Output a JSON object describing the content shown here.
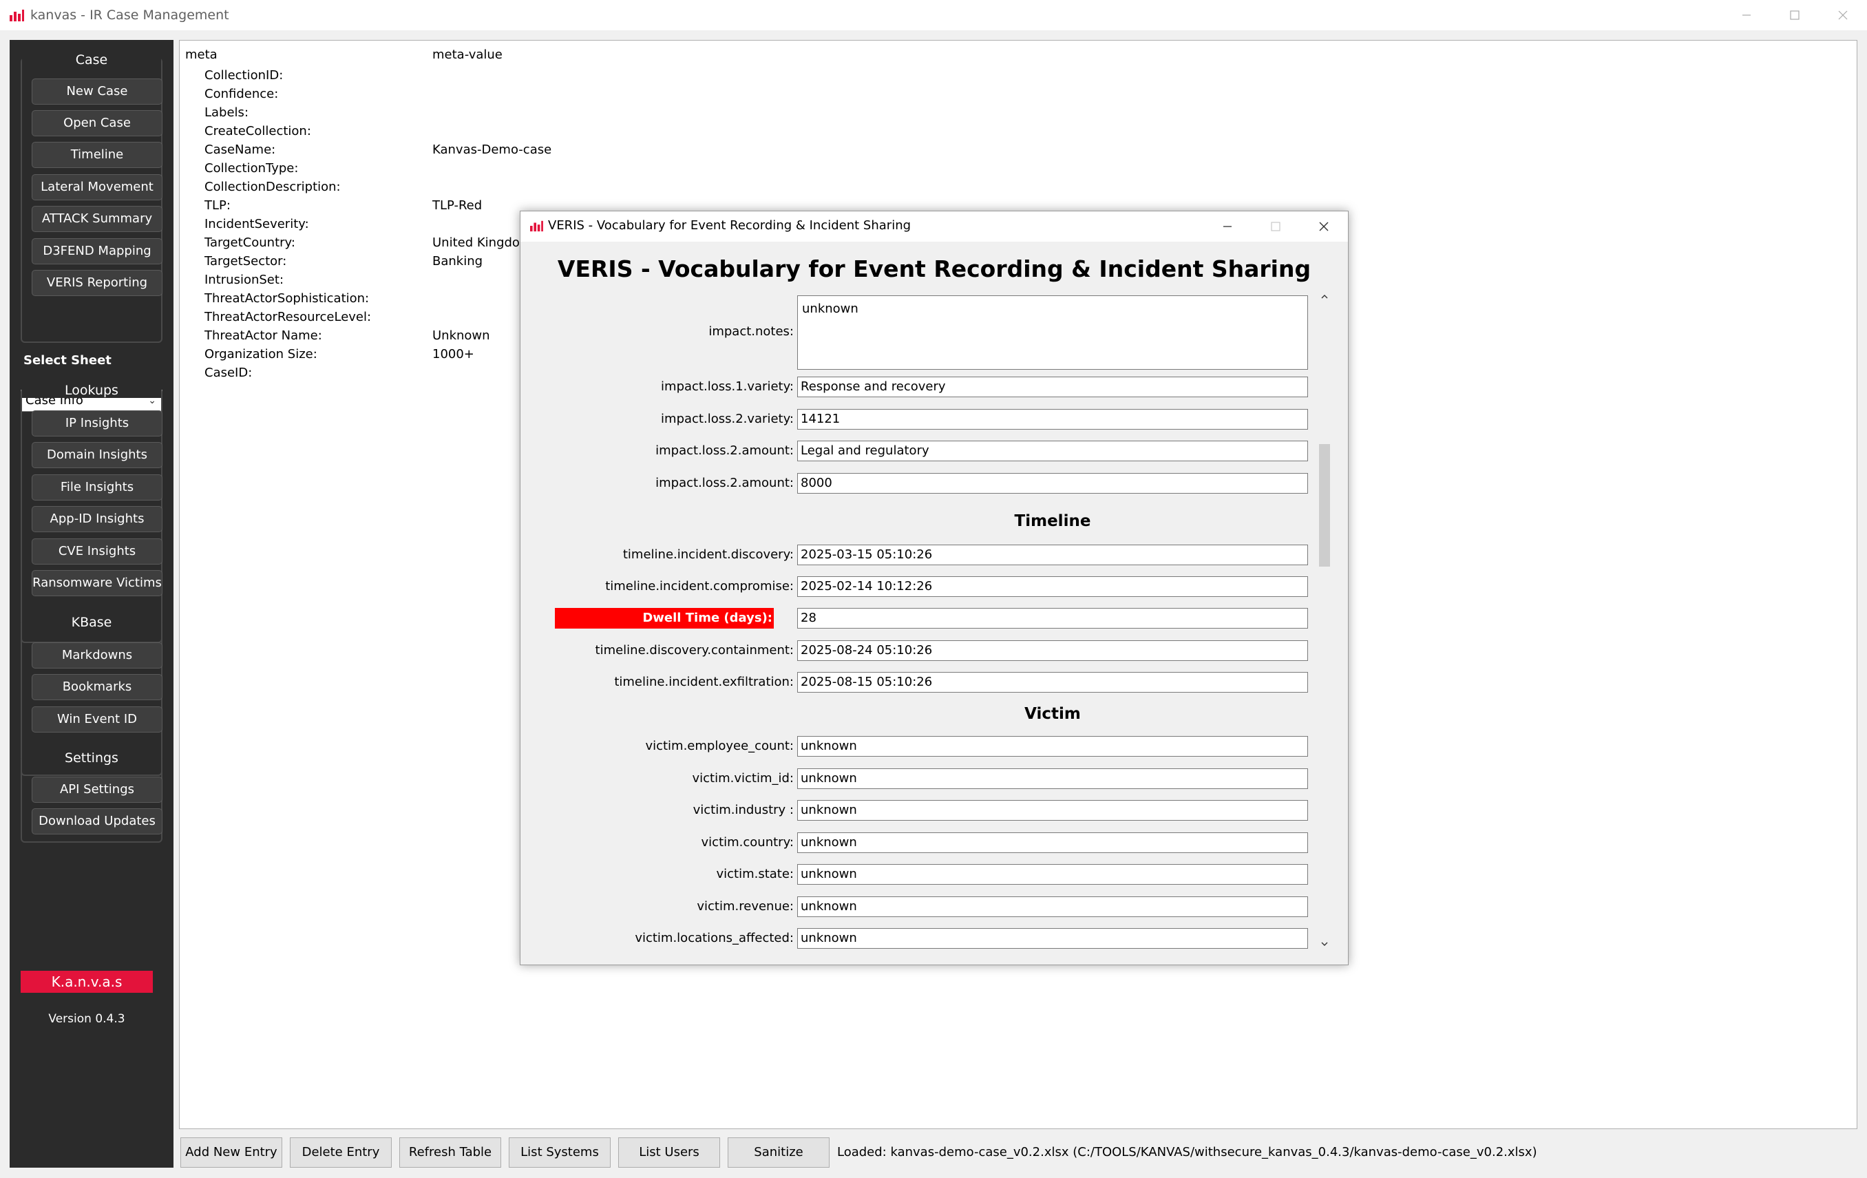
{
  "window": {
    "title": "kanvas - IR Case Management",
    "accent_color": "#e3133b"
  },
  "sidebar": {
    "case": {
      "title": "Case",
      "buttons": [
        "New Case",
        "Open Case",
        "Timeline",
        "Lateral Movement",
        "ATTACK Summary",
        "D3FEND Mapping",
        "VERIS Reporting"
      ]
    },
    "select_sheet_label": "Select Sheet",
    "sheet_select_value": "Case Info",
    "lookups": {
      "title": "Lookups",
      "buttons": [
        "IP Insights",
        "Domain Insights",
        "File Insights",
        "App-ID Insights",
        "CVE Insights",
        "Ransomware Victims"
      ]
    },
    "kbase": {
      "title": "KBase",
      "buttons": [
        "Markdowns",
        "Bookmarks",
        "Win Event ID"
      ]
    },
    "settings": {
      "title": "Settings",
      "buttons": [
        "API Settings",
        "Download Updates"
      ]
    },
    "brand": "K.a.n.v.a.s",
    "version": "Version 0.4.3"
  },
  "table": {
    "headers": [
      "meta",
      "meta-value"
    ],
    "rows": [
      {
        "key": "CollectionID:",
        "value": ""
      },
      {
        "key": "Confidence:",
        "value": ""
      },
      {
        "key": "Labels:",
        "value": ""
      },
      {
        "key": "CreateCollection:",
        "value": ""
      },
      {
        "key": "CaseName:",
        "value": "Kanvas-Demo-case"
      },
      {
        "key": "CollectionType:",
        "value": ""
      },
      {
        "key": "CollectionDescription:",
        "value": ""
      },
      {
        "key": "TLP:",
        "value": "TLP-Red"
      },
      {
        "key": "IncidentSeverity:",
        "value": ""
      },
      {
        "key": "TargetCountry:",
        "value": "United Kingdom"
      },
      {
        "key": "TargetSector:",
        "value": "Banking"
      },
      {
        "key": "IntrusionSet:",
        "value": ""
      },
      {
        "key": "ThreatActorSophistication:",
        "value": ""
      },
      {
        "key": "ThreatActorResourceLevel:",
        "value": ""
      },
      {
        "key": "ThreatActor Name:",
        "value": "Unknown"
      },
      {
        "key": "Organization Size:",
        "value": "1000+"
      },
      {
        "key": "CaseID:",
        "value": ""
      }
    ]
  },
  "bottom_bar": {
    "buttons": [
      "Add New Entry",
      "Delete Entry",
      "Refresh Table",
      "List Systems",
      "List Users",
      "Sanitize"
    ],
    "status": "Loaded: kanvas-demo-case_v0.2.xlsx (C:/TOOLS/KANVAS/withsecure_kanvas_0.4.3/kanvas-demo-case_v0.2.xlsx)"
  },
  "dialog": {
    "title": "VERIS - Vocabulary for Event Recording & Incident Sharing",
    "heading": "VERIS - Vocabulary for Event Recording & Incident Sharing",
    "impact_notes": {
      "label": "impact.notes:",
      "value": "unknown"
    },
    "impact_fields": [
      {
        "label": "impact.loss.1.variety:",
        "value": "Response and recovery"
      },
      {
        "label": "impact.loss.2.variety:",
        "value": "14121"
      },
      {
        "label": "impact.loss.2.amount:",
        "value": "Legal and regulatory"
      },
      {
        "label": "impact.loss.2.amount:",
        "value": "8000"
      }
    ],
    "timeline_title": "Timeline",
    "timeline_fields": [
      {
        "label": "timeline.incident.discovery:",
        "value": "2025-03-15 05:10:26"
      },
      {
        "label": "timeline.incident.compromise:",
        "value": "2025-02-14 10:12:26"
      },
      {
        "label": "Dwell Time (days):",
        "value": "28"
      },
      {
        "label": "timeline.discovery.containment:",
        "value": "2025-08-24 05:10:26"
      },
      {
        "label": "timeline.incident.exfiltration:",
        "value": "2025-08-15 05:10:26"
      }
    ],
    "victim_title": "Victim",
    "victim_fields": [
      {
        "label": "victim.employee_count:",
        "value": "unknown"
      },
      {
        "label": "victim.victim_id:",
        "value": "unknown"
      },
      {
        "label": "victim.industry :",
        "value": "unknown"
      },
      {
        "label": "victim.country:",
        "value": "unknown"
      },
      {
        "label": "victim.state:",
        "value": "unknown"
      },
      {
        "label": "victim.revenue:",
        "value": "unknown"
      },
      {
        "label": "victim.locations_affected:",
        "value": "unknown"
      }
    ],
    "highlight_color": "#ff0000"
  }
}
